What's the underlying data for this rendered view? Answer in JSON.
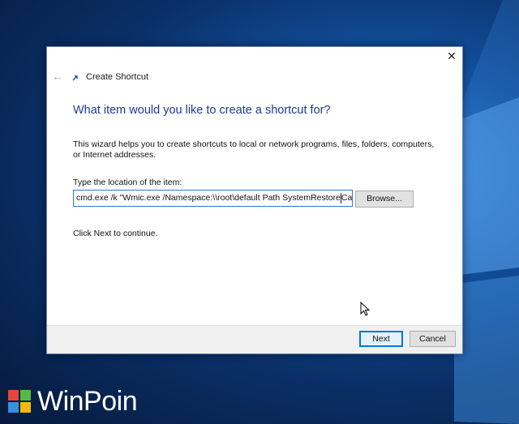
{
  "window": {
    "title": "Create Shortcut",
    "close_glyph": "✕",
    "back_glyph": "←"
  },
  "main": {
    "heading": "What item would you like to create a shortcut for?",
    "description": "This wizard helps you to create shortcuts to local or network programs, files, folders, computers, or Internet addresses.",
    "location_label": "Type the location of the item:",
    "location_value": "cmd.exe /k \"Wmic.exe /Namespace:\\\\root\\default Path SystemRestore",
    "location_value_tail": "Call (",
    "browse_label": "Browse...",
    "continue_text": "Click Next to continue."
  },
  "footer": {
    "next_label": "Next",
    "cancel_label": "Cancel"
  },
  "watermark": {
    "text": "WinPoin",
    "colors": [
      "#e8453c",
      "#55b948",
      "#3b8fe0",
      "#f6b80a"
    ]
  },
  "colors": {
    "accent": "#0078d7",
    "heading": "#1b3a9a"
  }
}
